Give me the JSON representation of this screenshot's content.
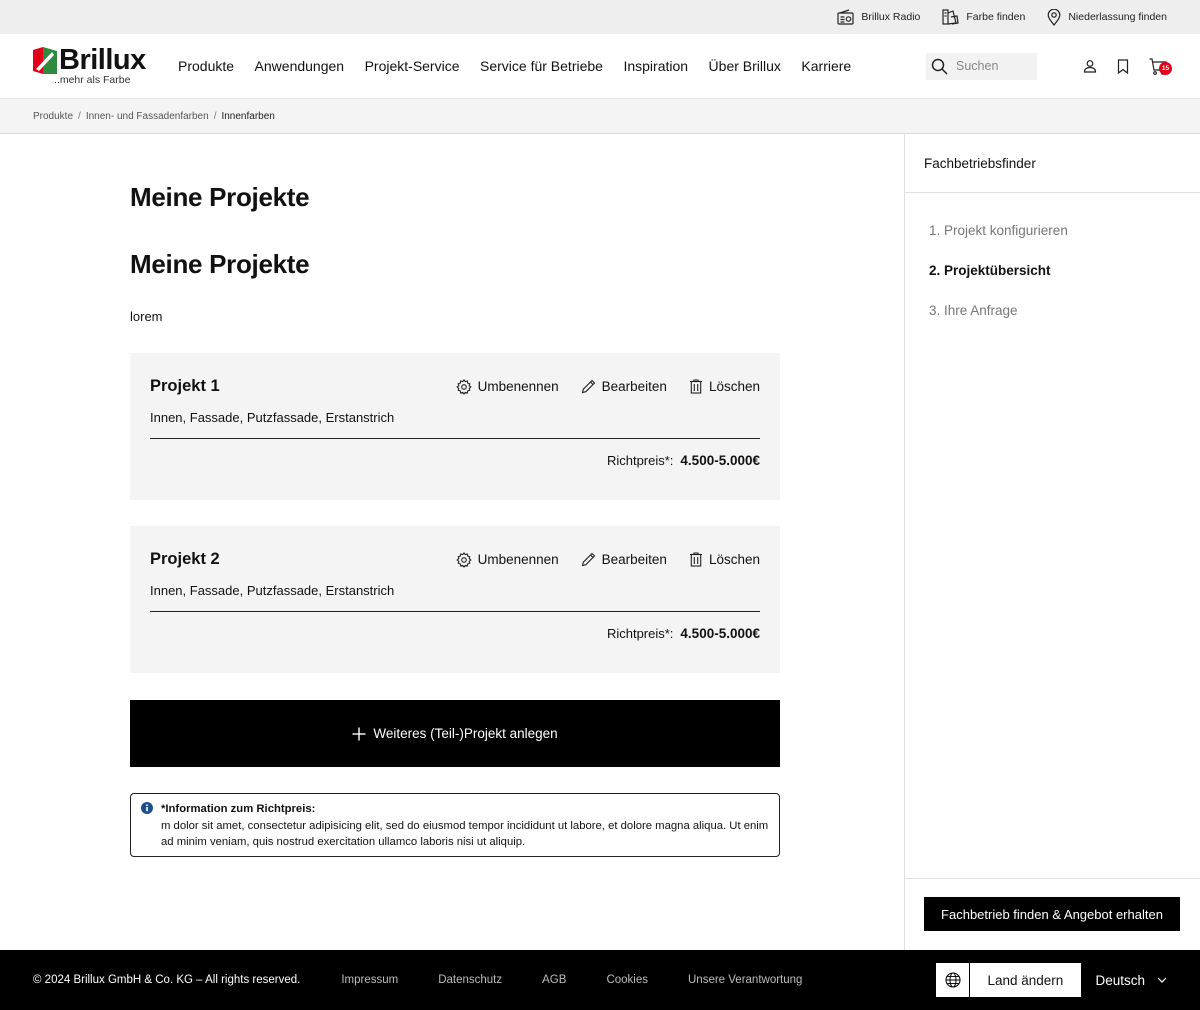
{
  "utility": {
    "links": [
      {
        "label": "Brillux Radio",
        "icon": "radio-icon"
      },
      {
        "label": "Farbe finden",
        "icon": "color-palette-icon"
      },
      {
        "label": "Niederlassung finden",
        "icon": "location-pin-icon"
      }
    ]
  },
  "header": {
    "logo_word": "Brillux",
    "logo_tagline": "..mehr als Farbe",
    "nav": [
      "Produkte",
      "Anwendungen",
      "Projekt-Service",
      "Service für Betriebe",
      "Inspiration",
      "Über Brillux",
      "Karriere"
    ],
    "search_placeholder": "Suchen",
    "cart_count": "15"
  },
  "breadcrumb": {
    "items": [
      "Produkte",
      "Innen- und Fassadenfarben"
    ],
    "current": "Innenfarben",
    "separator": "/"
  },
  "main": {
    "title": "Meine Projekte",
    "title_2": "Meine Projekte",
    "intro": "lorem",
    "projects": [
      {
        "name": "Projekt 1",
        "tags": "Innen, Fassade, Putzfassade, Erstanstrich",
        "price_label": "Richtpreis*:",
        "price_value": "4.500-5.000€"
      },
      {
        "name": "Projekt 2",
        "tags": "Innen, Fassade, Putzfassade, Erstanstrich",
        "price_label": "Richtpreis*:",
        "price_value": "4.500-5.000€"
      }
    ],
    "actions": {
      "rename": "Umbenennen",
      "edit": "Bearbeiten",
      "delete": "Löschen"
    },
    "add_project": "Weiteres (Teil-)Projekt anlegen",
    "info_title": "*Information zum Richtpreis:",
    "info_text": "m dolor sit amet, consectetur adipisicing elit, sed do eiusmod tempor incididunt ut labore, et dolore magna aliqua. Ut enim ad minim veniam, quis nostrud exercitation ullamco laboris nisi ut aliquip."
  },
  "sidebar": {
    "title": "Fachbetriebsfinder",
    "steps": [
      "1. Projekt konfigurieren",
      "2. Projektübersicht",
      "3. Ihre Anfrage"
    ],
    "active_step": 1,
    "cta": "Fachbetrieb finden & Angebot erhalten"
  },
  "footer": {
    "copyright": "© 2024 Brillux GmbH & Co. KG – All rights reserved.",
    "links": [
      "Impressum",
      "Datenschutz",
      "AGB",
      "Cookies",
      "Unsere Verantwortung"
    ],
    "country_button": "Land ändern",
    "language": "Deutsch"
  },
  "colors": {
    "accent_red": "#e2001a",
    "logo_green": "#2e8b3d",
    "info_blue": "#1a4f8c",
    "black": "#000000"
  }
}
